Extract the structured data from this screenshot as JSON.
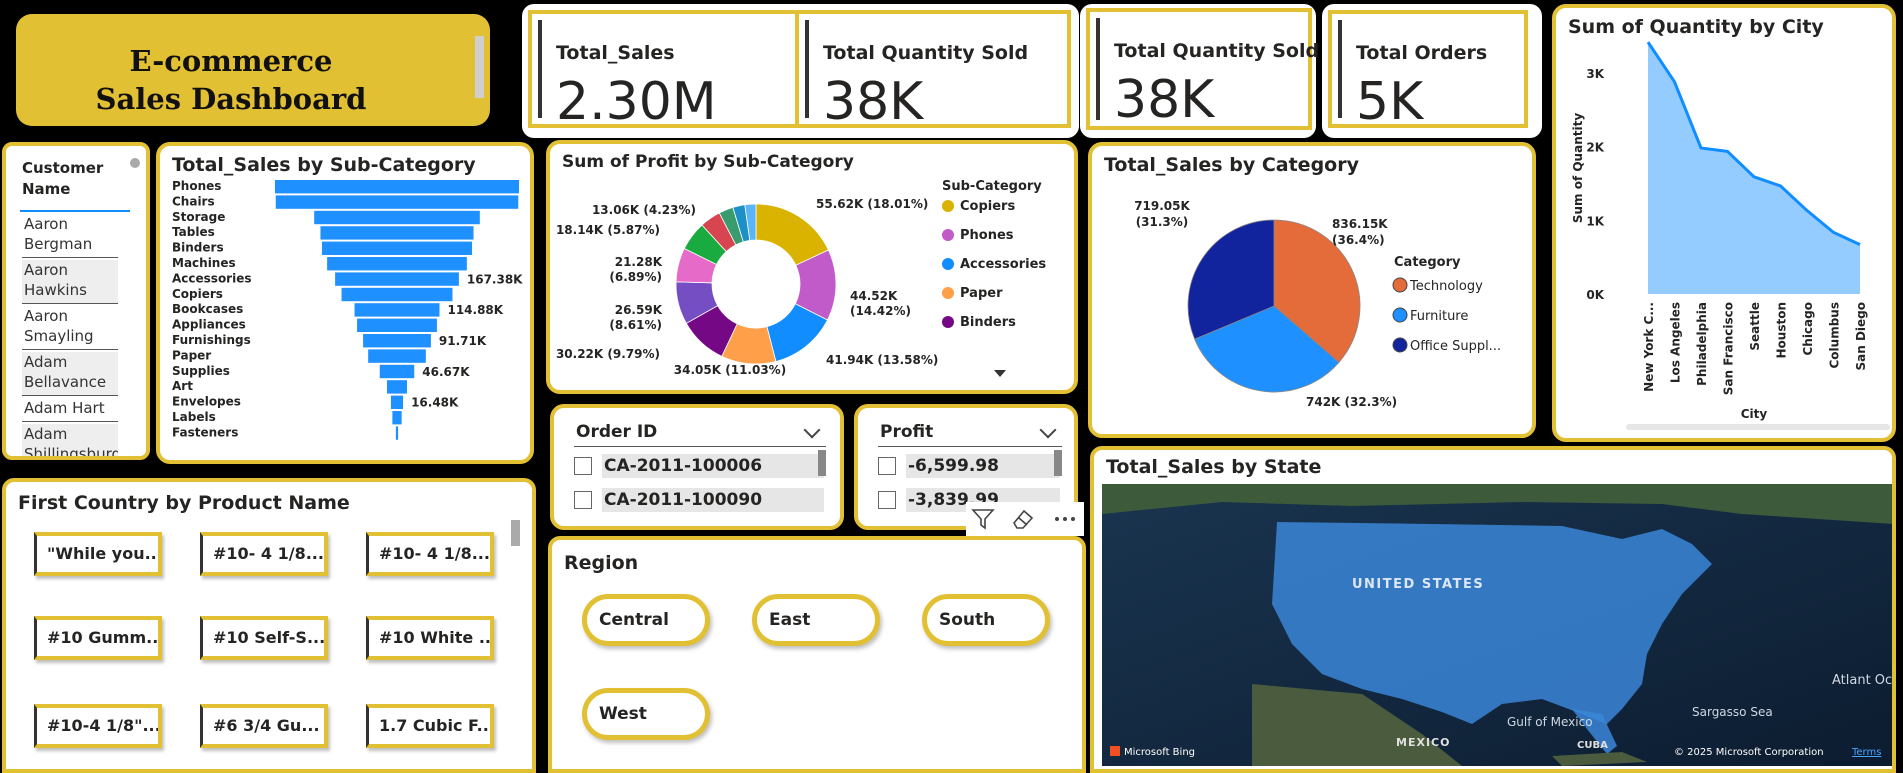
{
  "header": {
    "title_line1": "E-commerce",
    "title_line2": "Sales Dashboard"
  },
  "kpis": [
    {
      "label": "Total_Sales",
      "value": "2.30M"
    },
    {
      "label": "Total Quantity Sold",
      "value": "38K"
    },
    {
      "label": "Total Quantity Sold",
      "value": "38K"
    },
    {
      "label": "Total Orders",
      "value": "5K"
    }
  ],
  "customer_slicer": {
    "header": "Customer Name",
    "items": [
      "Aaron Bergman",
      "Aaron Hawkins",
      "Aaron Smayling",
      "Adam Bellavance",
      "Adam Hart",
      "Adam Shillingsburg"
    ]
  },
  "product_slicer": {
    "title": "First Country by Product Name",
    "items": [
      "\"While you...",
      "#10- 4 1/8...",
      "#10- 4 1/8...",
      "#10 Gumm...",
      "#10 Self-S...",
      "#10 White ...",
      "#10-4 1/8\"...",
      "#6 3/4 Gu...",
      "1.7 Cubic F..."
    ]
  },
  "order_slicer": {
    "title": "Order ID",
    "items": [
      "CA-2011-100006",
      "CA-2011-100090"
    ]
  },
  "profit_slicer": {
    "title": "Profit",
    "items": [
      "-6,599.98",
      "-3,839.99"
    ]
  },
  "region_slicer": {
    "title": "Region",
    "items": [
      "Central",
      "East",
      "South",
      "West"
    ]
  },
  "map": {
    "title": "Total_Sales by State",
    "country_label": "UNITED STATES",
    "gulf_label": "Gulf of Mexico",
    "mexico_label": "MEXICO",
    "cuba_label": "CUBA",
    "sargasso_label": "Sargasso Sea",
    "atlantic_label": "Atlant Ocea",
    "bing_label": "Microsoft Bing",
    "copyright": "© 2025 Microsoft Corporation",
    "terms": "Terms"
  },
  "chart_data": [
    {
      "type": "bar",
      "title": "Total_Sales by Sub-Category",
      "categories": [
        "Phones",
        "Chairs",
        "Storage",
        "Tables",
        "Binders",
        "Machines",
        "Accessories",
        "Copiers",
        "Bookcases",
        "Appliances",
        "Furnishings",
        "Paper",
        "Supplies",
        "Art",
        "Envelopes",
        "Labels",
        "Fasteners"
      ],
      "values": [
        330,
        328,
        224,
        207,
        203,
        189,
        167.38,
        150,
        114.88,
        108,
        91.71,
        78,
        46.67,
        27,
        16.48,
        12.5,
        3
      ],
      "data_labels": [
        {
          "category": "Accessories",
          "text": "167.38K"
        },
        {
          "category": "Bookcases",
          "text": "114.88K"
        },
        {
          "category": "Furnishings",
          "text": "91.71K"
        },
        {
          "category": "Supplies",
          "text": "46.67K"
        },
        {
          "category": "Envelopes",
          "text": "16.48K"
        }
      ],
      "color": "#1E90FF"
    },
    {
      "type": "pie",
      "title": "Sum of Profit by Sub-Category",
      "legend_title": "Sub-Category",
      "slices": [
        {
          "name": "Copiers",
          "value": 55.62,
          "label": "55.62K (18.01%)",
          "color": "#D9B300"
        },
        {
          "name": "Phones",
          "value": 44.52,
          "label": "44.52K (14.42%)",
          "color": "#C05BC9"
        },
        {
          "name": "Accessories",
          "value": 41.94,
          "label": "41.94K (13.58%)",
          "color": "#118DFF"
        },
        {
          "name": "Paper",
          "value": 34.05,
          "label": "34.05K (11.03%)",
          "color": "#FF9F4A"
        },
        {
          "name": "Binders",
          "value": 30.22,
          "label": "30.22K (9.79%)",
          "color": "#750985"
        },
        {
          "name": "",
          "value": 26.59,
          "label": "26.59K (8.61%)",
          "color": "#744EC2"
        },
        {
          "name": "",
          "value": 21.28,
          "label": "21.28K (6.89%)",
          "color": "#E66BC8"
        },
        {
          "name": "",
          "value": 18.14,
          "label": "18.14K (5.87%)",
          "color": "#1AAB40"
        },
        {
          "name": "",
          "value": 13.06,
          "label": "13.06K (4.23%)",
          "color": "#D64550"
        },
        {
          "name": "",
          "value": 9.0,
          "label": "",
          "color": "#3A9B6E"
        },
        {
          "name": "",
          "value": 7.5,
          "label": "",
          "color": "#1E90C8"
        },
        {
          "name": "",
          "value": 6.9,
          "label": "",
          "color": "#5BB4F5"
        }
      ]
    },
    {
      "type": "pie",
      "title": "Total_Sales by Category",
      "legend_title": "Category",
      "slices": [
        {
          "name": "Technology",
          "value": 836.15,
          "label": "836.15K (36.4%)",
          "color": "#E36C3A"
        },
        {
          "name": "Furniture",
          "value": 742,
          "label": "742K (32.3%)",
          "color": "#1E90FF"
        },
        {
          "name": "Office Suppl...",
          "value": 719.05,
          "label": "719.05K (31.3%)",
          "color": "#12239E"
        }
      ]
    },
    {
      "type": "area",
      "title": "Sum of Quantity by City",
      "xlabel": "City",
      "ylabel": "Sum of Quantity",
      "categories": [
        "New York C...",
        "Los Angeles",
        "Philadelphia",
        "San Francisco",
        "Seattle",
        "Houston",
        "Chicago",
        "Columbus",
        "San Diego"
      ],
      "values": [
        3417,
        2879,
        1981,
        1935,
        1590,
        1466,
        1132,
        836,
        670
      ],
      "ylim": [
        0,
        3500
      ],
      "yticks": [
        "0K",
        "1K",
        "2K",
        "3K"
      ],
      "color": "#118DFF"
    }
  ]
}
